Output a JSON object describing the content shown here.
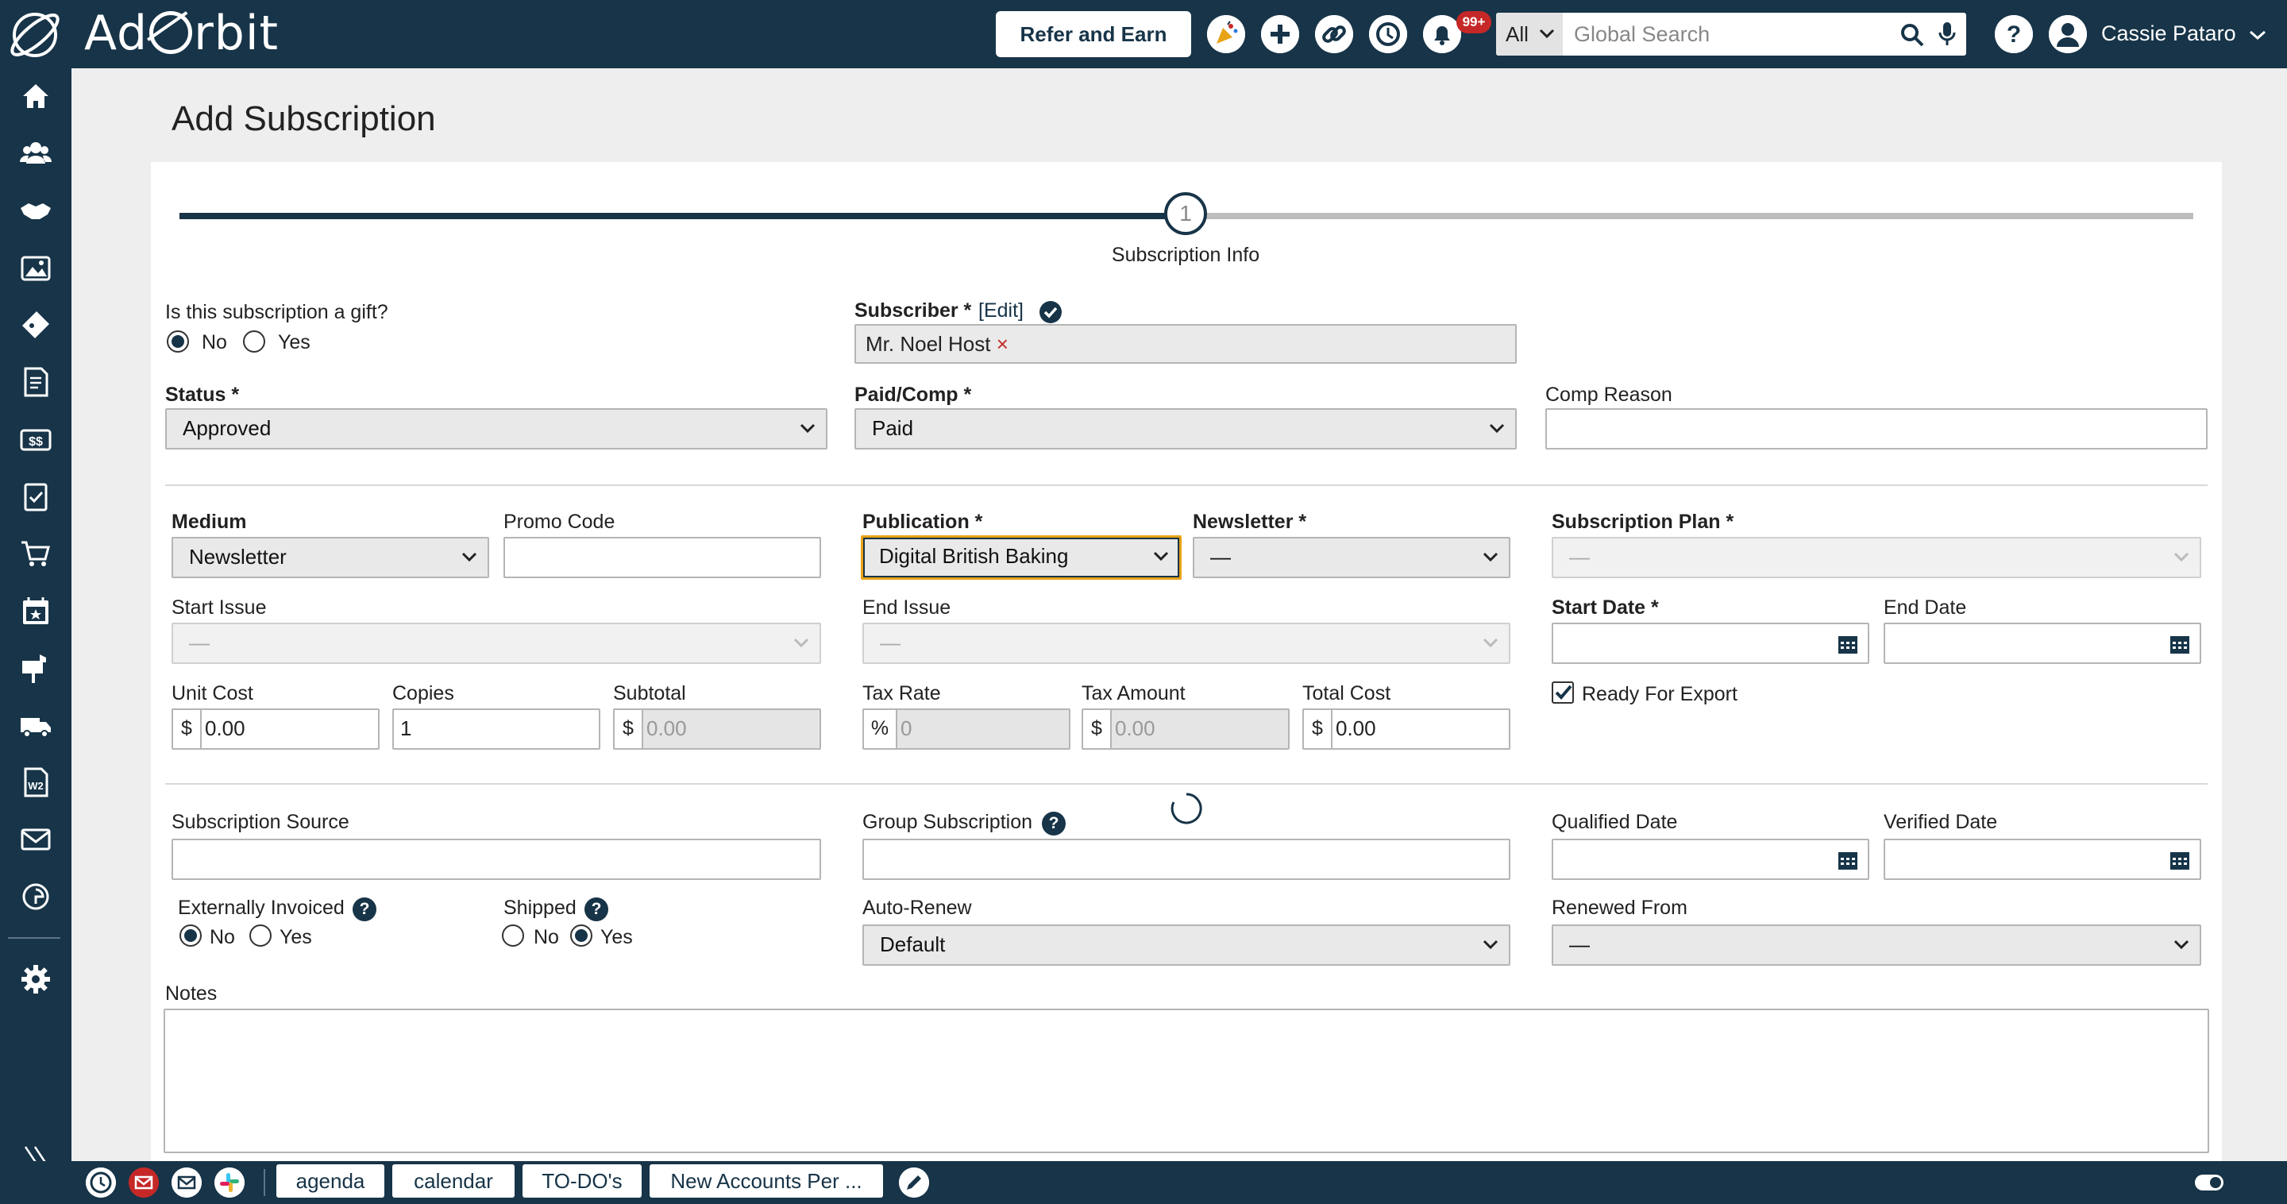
{
  "app": {
    "logo_text_left": "Ad",
    "logo_text_right": "rbit"
  },
  "header": {
    "refer_label": "Refer and Earn",
    "notifications_badge": "99+",
    "search_scope": "All",
    "search_placeholder": "Global Search",
    "help_label": "?",
    "user_name": "Cassie Pataro"
  },
  "sidebar": {
    "items": [
      {
        "icon": "home-icon"
      },
      {
        "icon": "contacts-icon"
      },
      {
        "icon": "handshake-icon"
      },
      {
        "icon": "media-icon"
      },
      {
        "icon": "ticket-icon"
      },
      {
        "icon": "invoice-icon"
      },
      {
        "icon": "billing-icon"
      },
      {
        "icon": "tasks-icon"
      },
      {
        "icon": "cart-icon"
      },
      {
        "icon": "calendar-icon"
      },
      {
        "icon": "mailbox-icon"
      },
      {
        "icon": "delivery-truck-icon"
      },
      {
        "icon": "w2-form-icon"
      },
      {
        "icon": "email-icon"
      },
      {
        "icon": "circulation-icon"
      },
      {
        "icon": "settings-icon"
      }
    ],
    "expand_icon": "double-chevron-right-icon"
  },
  "page": {
    "title": "Add Subscription",
    "step_number": "1",
    "step_label": "Subscription Info"
  },
  "form": {
    "gift": {
      "label": "Is this subscription a gift?",
      "no": "No",
      "yes": "Yes",
      "value": "No"
    },
    "subscriber": {
      "label": "Subscriber *",
      "edit_label": "[Edit]",
      "value": "Mr. Noel Host",
      "remove": "×"
    },
    "status": {
      "label": "Status *",
      "value": "Approved"
    },
    "paid_comp": {
      "label": "Paid/Comp *",
      "value": "Paid"
    },
    "comp_reason": {
      "label": "Comp Reason",
      "value": ""
    },
    "medium": {
      "label": "Medium",
      "value": "Newsletter"
    },
    "promo_code": {
      "label": "Promo Code",
      "value": ""
    },
    "publication": {
      "label": "Publication *",
      "value": "Digital British Baking"
    },
    "newsletter": {
      "label": "Newsletter *",
      "value": "—"
    },
    "subscription_plan": {
      "label": "Subscription Plan *",
      "value": "—"
    },
    "start_issue": {
      "label": "Start Issue",
      "value": "—"
    },
    "end_issue": {
      "label": "End Issue",
      "value": "—"
    },
    "start_date": {
      "label": "Start Date *",
      "value": ""
    },
    "end_date": {
      "label": "End Date",
      "value": ""
    },
    "unit_cost": {
      "label": "Unit Cost",
      "prefix": "$",
      "value": "0.00"
    },
    "copies": {
      "label": "Copies",
      "value": "1"
    },
    "subtotal": {
      "label": "Subtotal",
      "prefix": "$",
      "value": "0.00"
    },
    "tax_rate": {
      "label": "Tax Rate",
      "prefix": "%",
      "value": "0"
    },
    "tax_amount": {
      "label": "Tax Amount",
      "prefix": "$",
      "value": "0.00"
    },
    "total_cost": {
      "label": "Total Cost",
      "prefix": "$",
      "value": "0.00"
    },
    "ready_for_export": {
      "label": "Ready For Export",
      "checked": true
    },
    "subscription_source": {
      "label": "Subscription Source",
      "value": ""
    },
    "group_subscription": {
      "label": "Group Subscription",
      "value": ""
    },
    "qualified_date": {
      "label": "Qualified Date",
      "value": ""
    },
    "verified_date": {
      "label": "Verified Date",
      "value": ""
    },
    "externally_invoiced": {
      "label": "Externally Invoiced",
      "no": "No",
      "yes": "Yes",
      "value": "No"
    },
    "shipped": {
      "label": "Shipped",
      "no": "No",
      "yes": "Yes",
      "value": "Yes"
    },
    "auto_renew": {
      "label": "Auto-Renew",
      "value": "Default"
    },
    "renewed_from": {
      "label": "Renewed From",
      "value": "—"
    },
    "notes": {
      "label": "Notes",
      "value": ""
    }
  },
  "bottom_bar": {
    "tabs": [
      "agenda",
      "calendar",
      "TO-DO's",
      "New Accounts Per ..."
    ]
  },
  "colors": {
    "navy": "#173448",
    "badge_red": "#c62828",
    "focus_orange": "#e8a317"
  }
}
